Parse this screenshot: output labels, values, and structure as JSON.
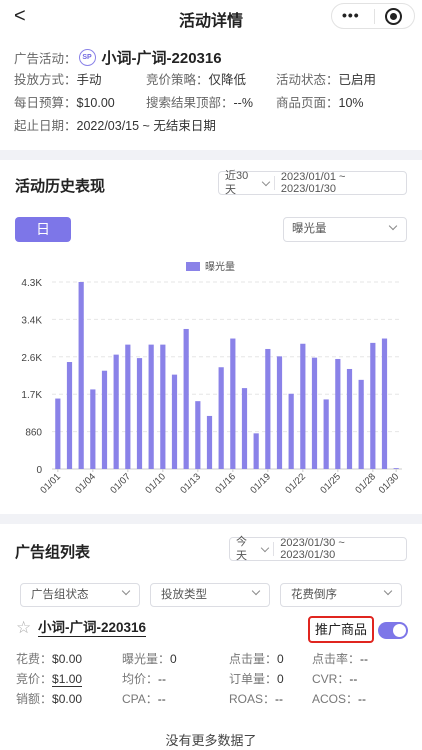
{
  "nav": {
    "back_glyph": "<",
    "title": "活动详情",
    "more_icon": "more-dots-icon",
    "close_icon": "target-icon"
  },
  "campaign": {
    "label": "广告活动：",
    "badge": "SP",
    "name": "小词-广词-220316",
    "fields": [
      {
        "label": "投放方式：",
        "value": "手动"
      },
      {
        "label": "竞价策略：",
        "value": "仅降低"
      },
      {
        "label": "活动状态：",
        "value": "已启用"
      },
      {
        "label": "每日预算：",
        "value": "$10.00"
      },
      {
        "label": "搜索结果顶部：",
        "value": "--%"
      },
      {
        "label": "商品页面：",
        "value": "10%"
      },
      {
        "label": "起止日期：",
        "value": "2022/03/15 ~ 无结束日期"
      }
    ]
  },
  "history": {
    "title": "活动历史表现",
    "range_preset": "近30天",
    "range_dates": "2023/01/01 ~ 2023/01/30",
    "day_button": "日",
    "metric_select": "曝光量"
  },
  "chart_data": {
    "type": "bar",
    "legend": "曝光量",
    "legend_position": "top-center",
    "grid": true,
    "color": "#8a82e8",
    "ylim": [
      0,
      4300
    ],
    "y_ticks": [
      "0",
      "860",
      "1.7K",
      "2.6K",
      "3.4K",
      "4.3K"
    ],
    "x_tick_labels": [
      "01/01",
      "01/04",
      "01/07",
      "01/10",
      "01/13",
      "01/16",
      "01/19",
      "01/22",
      "01/25",
      "01/28",
      "01/30"
    ],
    "categories": [
      "01/01",
      "01/02",
      "01/03",
      "01/04",
      "01/05",
      "01/06",
      "01/07",
      "01/08",
      "01/09",
      "01/10",
      "01/11",
      "01/12",
      "01/13",
      "01/14",
      "01/15",
      "01/16",
      "01/17",
      "01/18",
      "01/19",
      "01/20",
      "01/21",
      "01/22",
      "01/23",
      "01/24",
      "01/25",
      "01/26",
      "01/27",
      "01/28",
      "01/29",
      "01/30"
    ],
    "values": [
      1620,
      2460,
      4300,
      1830,
      2260,
      2630,
      2860,
      2550,
      2860,
      2860,
      2170,
      3220,
      1560,
      1220,
      2340,
      3000,
      1860,
      820,
      2760,
      2590,
      1730,
      2880,
      2560,
      1600,
      2530,
      2300,
      2050,
      2900,
      3000,
      20
    ]
  },
  "ad_groups": {
    "title": "广告组列表",
    "range_preset": "今天",
    "range_dates": "2023/01/30 ~ 2023/01/30",
    "filters": [
      "广告组状态",
      "投放类型",
      "花费倒序"
    ],
    "item": {
      "name": "小词-广词-220316",
      "promo_button": "推广商品",
      "toggle_on": true,
      "stats": [
        {
          "label": "花费：",
          "value": "$0.00"
        },
        {
          "label": "曝光量：",
          "value": "0"
        },
        {
          "label": "点击量：",
          "value": "0"
        },
        {
          "label": "点击率：",
          "value": "--"
        },
        {
          "label": "竞价：",
          "value": "$1.00"
        },
        {
          "label": "均价：",
          "value": "--"
        },
        {
          "label": "订单量：",
          "value": "0"
        },
        {
          "label": "CVR：",
          "value": "--"
        },
        {
          "label": "销额：",
          "value": "$0.00"
        },
        {
          "label": "CPA：",
          "value": "--"
        },
        {
          "label": "ROAS：",
          "value": "--"
        },
        {
          "label": "ACOS：",
          "value": "--"
        }
      ]
    },
    "footer": "没有更多数据了"
  }
}
